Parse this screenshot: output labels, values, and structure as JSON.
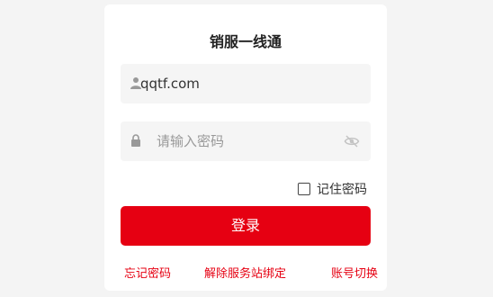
{
  "login": {
    "title": "销服一线通",
    "username": {
      "value": "qqtf.com",
      "icon": "user-icon"
    },
    "password": {
      "placeholder": "请输入密码",
      "icon": "lock-icon",
      "toggle_icon": "eye-off-icon"
    },
    "remember_label": "记住密码",
    "remember_checked": false,
    "login_button": "登录",
    "links": {
      "forgot": "忘记密码",
      "unbind": "解除服务站绑定",
      "switch": "账号切换"
    }
  },
  "colors": {
    "accent": "#e60012",
    "field_bg": "#f5f5f5",
    "page_bg": "#f4f4f4"
  }
}
